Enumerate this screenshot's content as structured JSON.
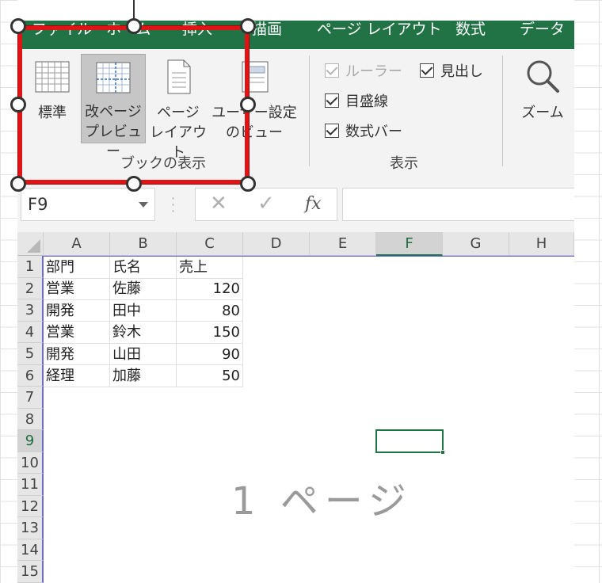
{
  "ribbon_tabs": [
    "ファイル",
    "ホーム",
    "挿入",
    "描画",
    "ページ レイアウト",
    "数式",
    "データ"
  ],
  "workbook_views": {
    "group_label": "ブックの表示",
    "buttons": [
      {
        "line1": "標準",
        "line2": ""
      },
      {
        "line1": "改ページ",
        "line2": "プレビュー"
      },
      {
        "line1": "ページ",
        "line2": "レイアウト"
      },
      {
        "line1": "ユーザー設定",
        "line2": "のビュー"
      }
    ]
  },
  "show_group": {
    "group_label": "表示",
    "checkboxes": [
      {
        "label": "ルーラー",
        "checked": true,
        "disabled": true
      },
      {
        "label": "見出し",
        "checked": true,
        "disabled": false
      },
      {
        "label": "目盛線",
        "checked": true,
        "disabled": false
      },
      {
        "label": "数式バー",
        "checked": true,
        "disabled": false
      }
    ]
  },
  "zoom": {
    "label": "ズーム"
  },
  "formula_bar": {
    "name_box": "F9",
    "cancel": "✕",
    "enter": "✓",
    "fx": "fx"
  },
  "columns": [
    "A",
    "B",
    "C",
    "D",
    "E",
    "F",
    "G",
    "H"
  ],
  "selected_column": "F",
  "rows": [
    "1",
    "2",
    "3",
    "4",
    "5",
    "6",
    "7",
    "8",
    "9",
    "10",
    "11",
    "12",
    "13",
    "14",
    "15"
  ],
  "selected_row": "9",
  "table": {
    "headers": [
      "部門",
      "氏名",
      "売上"
    ],
    "data": [
      [
        "営業",
        "佐藤",
        "120"
      ],
      [
        "開発",
        "田中",
        "80"
      ],
      [
        "営業",
        "鈴木",
        "150"
      ],
      [
        "開発",
        "山田",
        "90"
      ],
      [
        "経理",
        "加藤",
        "50"
      ]
    ]
  },
  "page_watermark": "1 ページ"
}
